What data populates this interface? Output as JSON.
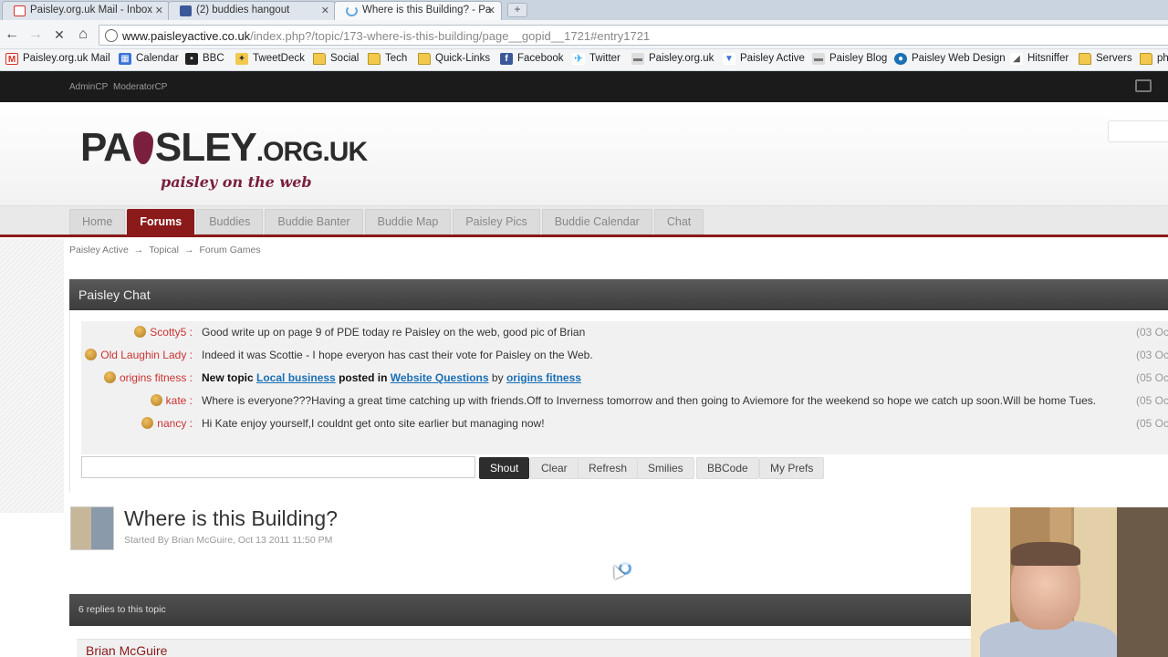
{
  "browser": {
    "tabs": [
      {
        "label": "Paisley.org.uk Mail - Inbox",
        "favicon": "gmail-icon",
        "color": "#d93025"
      },
      {
        "label": "(2) buddies hangout",
        "favicon": "facebook-icon",
        "color": "#3b5998"
      },
      {
        "label": "Where is this Building? - Pa",
        "favicon": "loading-icon",
        "color": "#6aa7e0"
      }
    ],
    "url_host": "www.paisleyactive.co.uk",
    "url_path": "/index.php?/topic/173-where-is-this-building/page__gopid__1721#entry1721",
    "bookmarks": [
      {
        "label": "Paisley.org.uk Mail",
        "icon": "gmail-icon"
      },
      {
        "label": "Calendar",
        "icon": "calendar-icon"
      },
      {
        "label": "BBC",
        "icon": "bbc-icon"
      },
      {
        "label": "TweetDeck",
        "icon": "tweetdeck-icon"
      },
      {
        "label": "Social",
        "icon": "folder-icon"
      },
      {
        "label": "Tech",
        "icon": "folder-icon"
      },
      {
        "label": "Quick-Links",
        "icon": "folder-icon"
      },
      {
        "label": "Facebook",
        "icon": "facebook-icon"
      },
      {
        "label": "Twitter",
        "icon": "twitter-icon"
      },
      {
        "label": "Paisley.org.uk",
        "icon": "site-icon"
      },
      {
        "label": "Paisley Active",
        "icon": "site-icon"
      },
      {
        "label": "Paisley Blog",
        "icon": "site-icon"
      },
      {
        "label": "Paisley Web Design",
        "icon": "drupal-icon"
      },
      {
        "label": "Hitsniffer",
        "icon": "chart-icon"
      },
      {
        "label": "Servers",
        "icon": "folder-icon"
      },
      {
        "label": "ph",
        "icon": "folder-icon"
      }
    ]
  },
  "site": {
    "admin_links": [
      "AdminCP",
      "ModeratorCP"
    ],
    "logo_left": "PA",
    "logo_right": "SLEY",
    "logo_domain": ".ORG.UK",
    "logo_tagline": "paisley on the web",
    "nav": [
      "Home",
      "Forums",
      "Buddies",
      "Buddie Banter",
      "Buddie Map",
      "Paisley Pics",
      "Buddie Calendar",
      "Chat"
    ],
    "nav_active": "Forums",
    "breadcrumbs": [
      "Paisley Active",
      "Topical",
      "Forum Games"
    ]
  },
  "chat": {
    "title": "Paisley Chat",
    "messages": [
      {
        "user": "Scotty5",
        "text": "Good write up on page 9 of PDE today re Paisley on the web, good pic of Brian",
        "date": "(03 Oc"
      },
      {
        "user": "Old Laughin Lady",
        "text": "Indeed it was Scottie - I hope everyon has cast their vote for Paisley on the Web.",
        "date": "(03 Oc"
      },
      {
        "user": "origins fitness",
        "text_prefix": "New topic",
        "link1": "Local business",
        "text_mid": "posted in",
        "link2": "Website Questions",
        "text_by": "by",
        "link3": "origins fitness",
        "date": "(05 Oc"
      },
      {
        "user": "kate",
        "text": "Where is everyone???Having a great time catching up with friends.Off to Inverness tomorrow and then going to Aviemore for the weekend so hope we catch up soon.Will be home Tues.",
        "date": "(05 Oc"
      },
      {
        "user": "nancy",
        "text": "Hi Kate enjoy yourself,I couldnt get onto site earlier but managing now!",
        "date": "(05 Oc"
      }
    ],
    "buttons": {
      "shout": "Shout",
      "clear": "Clear",
      "refresh": "Refresh",
      "smilies": "Smilies",
      "bbcode": "BBCode",
      "prefs": "My Prefs"
    }
  },
  "topic": {
    "title": "Where is this Building?",
    "meta": "Started By Brian McGuire, Oct 13 2011 11:50 PM",
    "replies": "6 replies to this topic",
    "first_poster": "Brian McGuire"
  }
}
